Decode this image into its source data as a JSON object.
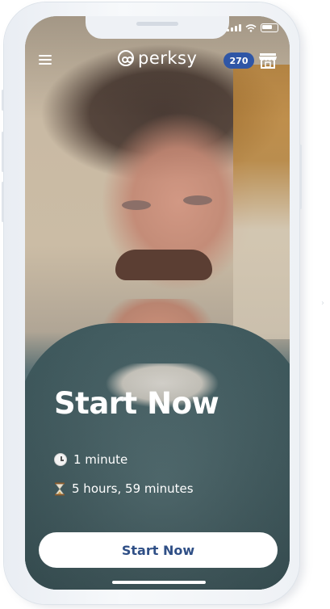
{
  "app": {
    "brand": "perksy",
    "points_badge": "270"
  },
  "icons": {
    "menu": "hamburger-menu-icon",
    "logo": "perksy-logo-icon",
    "store": "store-icon",
    "clock": "clock-icon",
    "hourglass": "hourglass-icon",
    "signal": "cellular-signal-icon",
    "wifi": "wifi-icon",
    "battery": "battery-icon"
  },
  "main": {
    "title": "Start Now",
    "duration": "1 minute",
    "expiry": "5 hours, 59 minutes",
    "cta_label": "Start Now"
  },
  "colors": {
    "badge": "#2f56a6",
    "cta_text": "#2f4f86",
    "cta_bg": "#ffffff"
  }
}
